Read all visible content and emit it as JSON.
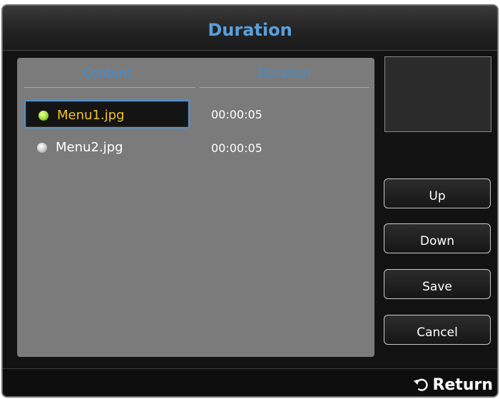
{
  "dialog": {
    "title": "Duration"
  },
  "table": {
    "headers": {
      "content": "Content",
      "duration": "Duration"
    },
    "rows": [
      {
        "name": "Menu1.jpg",
        "duration": "00:00:05",
        "selected": true
      },
      {
        "name": "Menu2.jpg",
        "duration": "00:00:05",
        "selected": false
      }
    ]
  },
  "buttons": {
    "up": "Up",
    "down": "Down",
    "save": "Save",
    "cancel": "Cancel"
  },
  "footer": {
    "return_label": "Return",
    "return_icon": "return-arrow-icon"
  },
  "colors": {
    "title": "#5aa0dc",
    "header": "#3f8fd2",
    "selected_text": "#f2c32a",
    "focus_border": "#4c92cc",
    "panel": "#7b7b7b"
  }
}
